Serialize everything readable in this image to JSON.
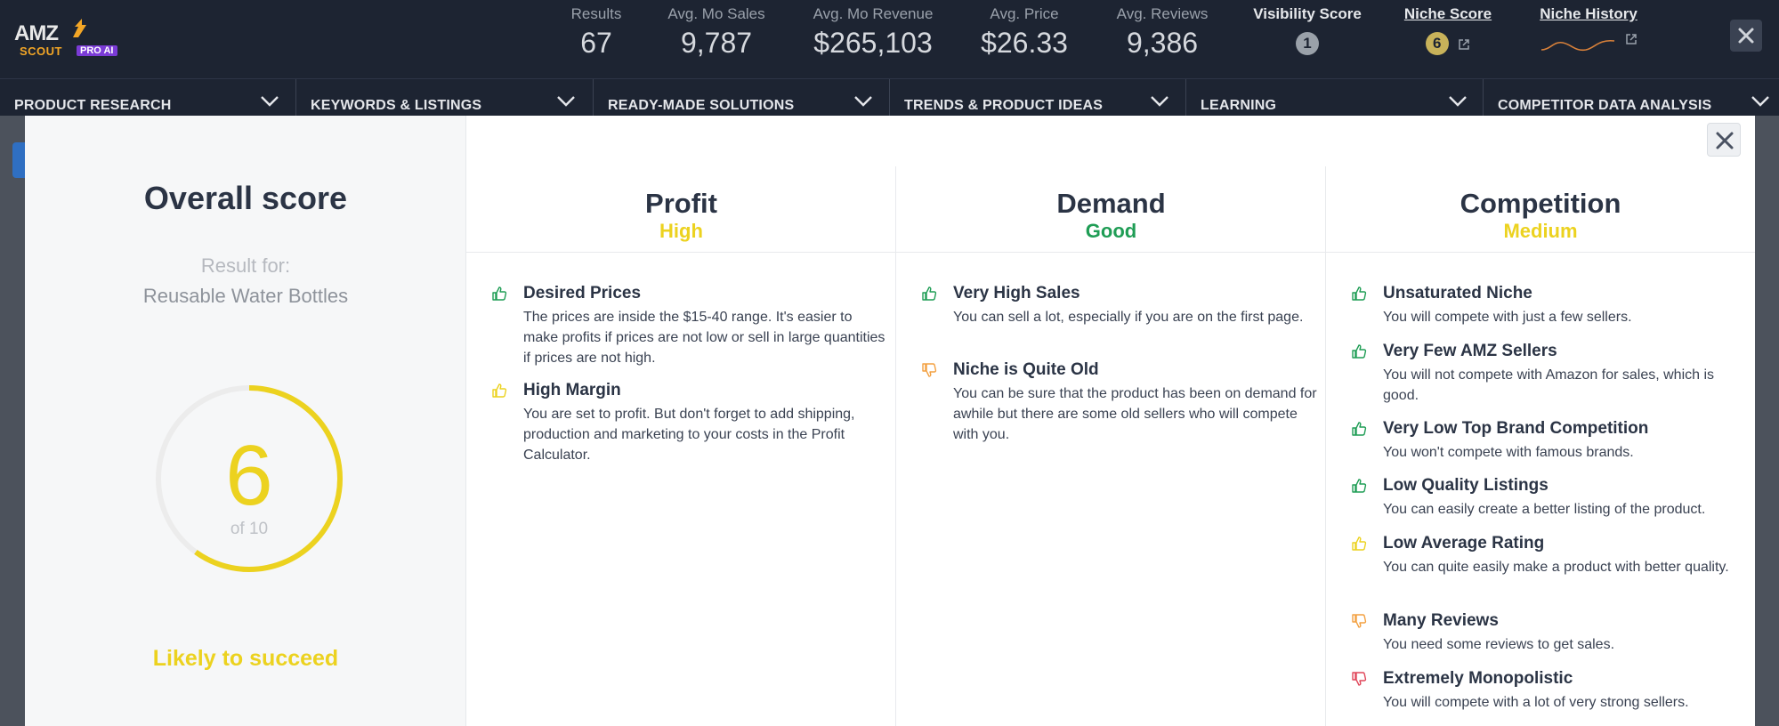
{
  "brand": {
    "amz": "AMZ",
    "scout": "SCOUT",
    "pro": "PRO AI"
  },
  "stats": [
    {
      "label": "Results",
      "value": "67"
    },
    {
      "label": "Avg. Mo Sales",
      "value": "9,787"
    },
    {
      "label": "Avg. Mo Revenue",
      "value": "$265,103"
    },
    {
      "label": "Avg. Price",
      "value": "$26.33"
    },
    {
      "label": "Avg. Reviews",
      "value": "9,386"
    }
  ],
  "visibility": {
    "label": "Visibility Score",
    "value": "1",
    "color": "#9aa1a9"
  },
  "niche_score": {
    "label": "Niche Score",
    "value": "6",
    "color": "#c8b25a"
  },
  "niche_history": {
    "label": "Niche History"
  },
  "nav": [
    {
      "label": "PRODUCT RESEARCH"
    },
    {
      "label": "KEYWORDS & LISTINGS"
    },
    {
      "label": "READY-MADE SOLUTIONS"
    },
    {
      "label": "TRENDS & PRODUCT IDEAS"
    },
    {
      "label": "LEARNING"
    },
    {
      "label": "COMPETITOR DATA ANALYSIS"
    }
  ],
  "overall": {
    "title": "Overall score",
    "result_for": "Result for:",
    "product": "Reusable Water Bottles",
    "score": "6",
    "score_value": 6,
    "of": "of 10",
    "verdict": "Likely to succeed"
  },
  "colors": {
    "yellow": "#ecd21f",
    "green": "#1f9d55",
    "orange": "#f3a040",
    "red": "#e0475a"
  },
  "columns": [
    {
      "title": "Profit",
      "level": "High",
      "level_color": "#ecd21f",
      "items": [
        {
          "icon": "thumbs-up-icon",
          "tone": "green",
          "title": "Desired Prices",
          "desc": "The prices are inside the $15-40 range. It's easier to make profits if prices are not low or sell in large quantities if prices are not high."
        },
        {
          "icon": "thumbs-up-icon",
          "tone": "yellow",
          "title": "High Margin",
          "desc": "You are set to profit. But don't forget to add shipping, production and marketing to your costs in the Profit Calculator."
        }
      ]
    },
    {
      "title": "Demand",
      "level": "Good",
      "level_color": "#1f9d55",
      "items": [
        {
          "icon": "thumbs-up-icon",
          "tone": "green",
          "title": "Very High Sales",
          "desc": "You can sell a lot, especially if you are on the first page."
        },
        {
          "icon": "thumbs-down-icon",
          "tone": "orange",
          "title": "Niche is Quite Old",
          "desc": "You can be sure that the product has been on demand for awhile but there are some old sellers who will compete with you."
        }
      ]
    },
    {
      "title": "Competition",
      "level": "Medium",
      "level_color": "#ecd21f",
      "items": [
        {
          "icon": "thumbs-up-icon",
          "tone": "green",
          "title": "Unsaturated Niche",
          "desc": "You will compete with just a few sellers."
        },
        {
          "icon": "thumbs-up-icon",
          "tone": "green",
          "title": "Very Few AMZ Sellers",
          "desc": "You will not compete with Amazon for sales, which is good."
        },
        {
          "icon": "thumbs-up-icon",
          "tone": "green",
          "title": "Very Low Top Brand Competition",
          "desc": "You won't compete with famous brands."
        },
        {
          "icon": "thumbs-up-icon",
          "tone": "green",
          "title": "Low Quality Listings",
          "desc": "You can easily create a better listing of the product."
        },
        {
          "icon": "thumbs-up-icon",
          "tone": "yellow",
          "title": "Low Average Rating",
          "desc": "You can quite easily make a product with better quality."
        },
        {
          "icon": "thumbs-down-icon",
          "tone": "orange",
          "title": "Many Reviews",
          "desc": "You need some reviews to get sales."
        },
        {
          "icon": "thumbs-down-icon",
          "tone": "red",
          "title": "Extremely Monopolistic",
          "desc": "You will compete with a lot of very strong sellers."
        }
      ]
    }
  ]
}
